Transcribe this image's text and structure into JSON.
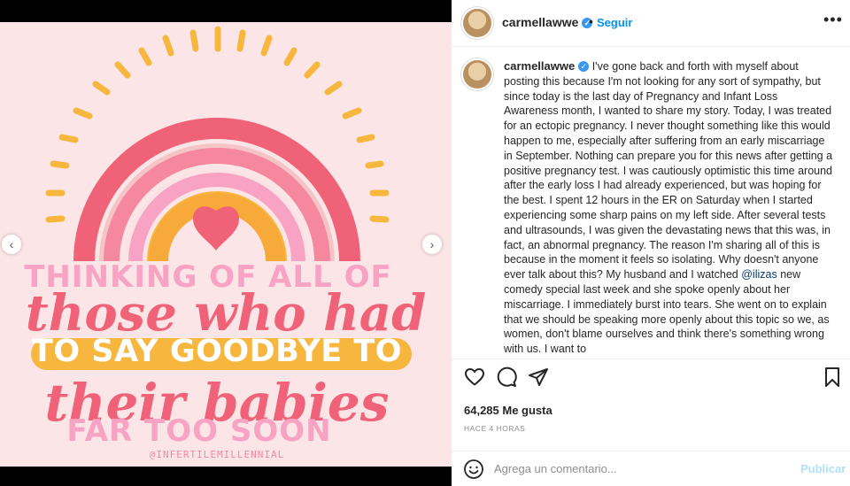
{
  "image": {
    "line1": "THINKING OF ALL OF",
    "line2": "those who had",
    "line3": "TO SAY GOODBYE TO",
    "line4": "their babies",
    "line5": "FAR TOO SOON",
    "credit": "@INFERTILEMILLENNIAL",
    "colors": {
      "background": "#fce5e6",
      "coral": "#f06277",
      "pink": "#f8a3c4",
      "orange": "#f7a93a",
      "yellow": "#f7b73e"
    }
  },
  "header": {
    "username": "carmellawwe",
    "separator": "•",
    "follow_label": "Seguir",
    "more_icon": "more-horizontal-icon"
  },
  "caption": {
    "username": "carmellawwe",
    "text_before_mention": "I've gone back and forth with myself about posting this because I'm not looking for any sort of sympathy, but since today is the last day of Pregnancy and Infant Loss Awareness month, I wanted to share my story. Today, I was treated for an ectopic pregnancy. I never thought something like this would happen to me, especially after suffering from an early miscarriage in September. Nothing can prepare you for this news after getting a positive pregnancy test. I was cautiously optimistic this time around after the early loss I had already experienced, but was hoping for the best. I spent 12 hours in the ER on Saturday when I started experiencing some sharp pains on my left side. After several tests and ultrasounds, I was given the devastating news that this was, in fact, an abnormal pregnancy. The reason I'm sharing all of this is because in the moment it feels so isolating. Why doesn't anyone ever talk about this? My husband and I watched ",
    "mention": "@ilizas",
    "text_after_mention": " new comedy special last week and she spoke openly about her miscarriage. I immediately burst into tears. She went on to explain that we should be speaking more openly about this topic so we, as women, don't blame ourselves and think there's something wrong with us. I want to"
  },
  "actions": {
    "icons": [
      "heart-icon",
      "comment-icon",
      "share-icon",
      "bookmark-icon"
    ]
  },
  "likes": "64,285 Me gusta",
  "timestamp": "HACE 4 HORAS",
  "comment": {
    "placeholder": "Agrega un comentario...",
    "post_label": "Publicar"
  },
  "colors": {
    "accent": "#0095f6",
    "verified": "#3897f0",
    "muted": "#8e8e8e",
    "post_disabled": "#b2dffc"
  }
}
